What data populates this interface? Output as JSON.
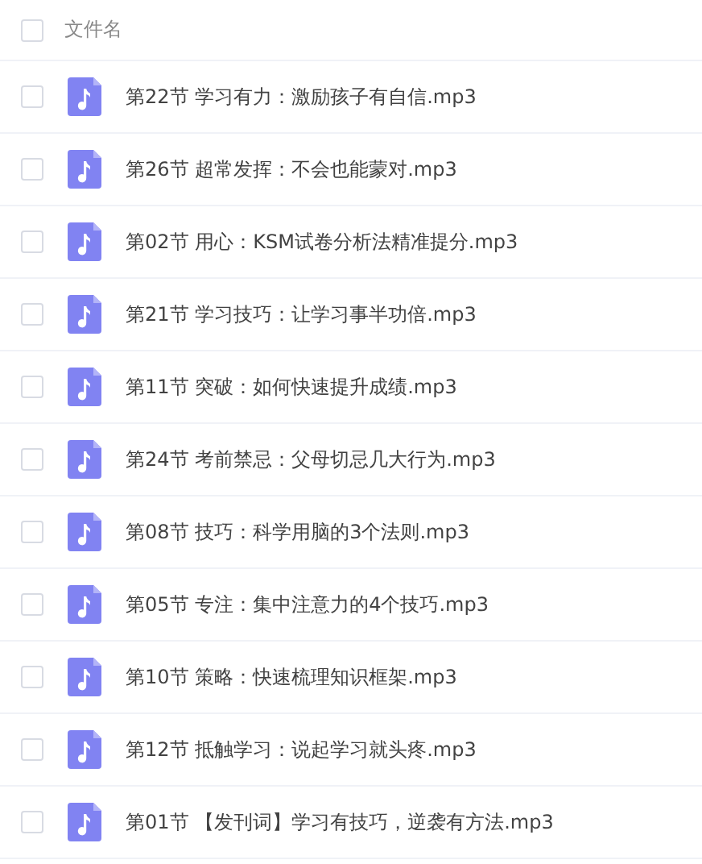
{
  "header": {
    "checked": false,
    "label": "文件名"
  },
  "files": [
    {
      "name": "第22节 学习有力：激励孩子有自信.mp3",
      "checked": false
    },
    {
      "name": "第26节 超常发挥：不会也能蒙对.mp3",
      "checked": false
    },
    {
      "name": "第02节 用心：KSM试卷分析法精准提分.mp3",
      "checked": false
    },
    {
      "name": "第21节 学习技巧：让学习事半功倍.mp3",
      "checked": false
    },
    {
      "name": "第11节 突破：如何快速提升成绩.mp3",
      "checked": false
    },
    {
      "name": "第24节 考前禁忌：父母切忌几大行为.mp3",
      "checked": false
    },
    {
      "name": "第08节 技巧：科学用脑的3个法则.mp3",
      "checked": false
    },
    {
      "name": "第05节 专注：集中注意力的4个技巧.mp3",
      "checked": false
    },
    {
      "name": "第10节 策略：快速梳理知识框架.mp3",
      "checked": false
    },
    {
      "name": "第12节 抵触学习：说起学习就头疼.mp3",
      "checked": false
    },
    {
      "name": "第01节 【发刊词】学习有技巧，逆袭有方法.mp3",
      "checked": false
    }
  ]
}
